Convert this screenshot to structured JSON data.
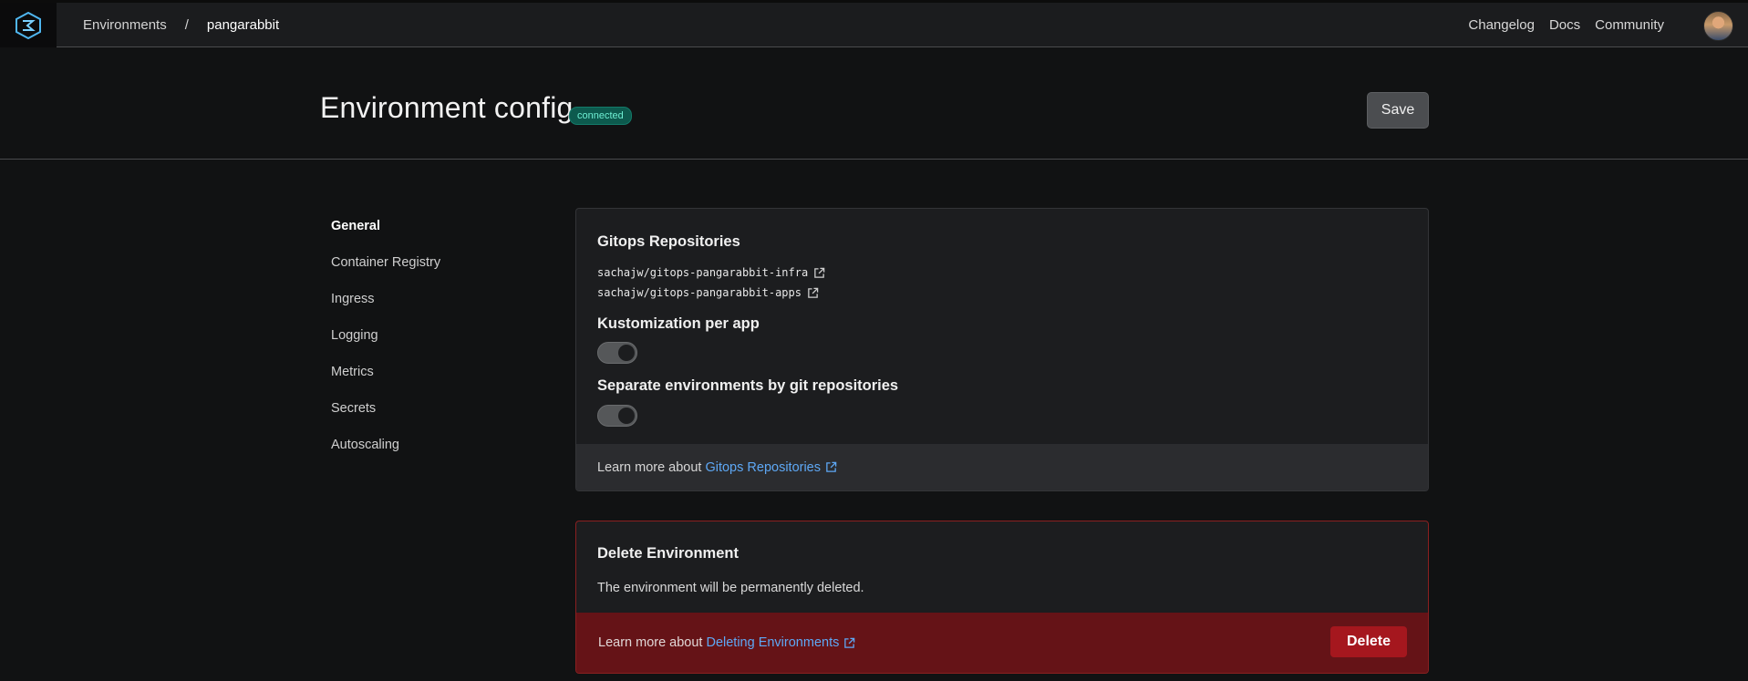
{
  "nav": {
    "breadcrumb": [
      "Environments",
      "pangarabbit"
    ],
    "separator": "/",
    "links": [
      "Changelog",
      "Docs",
      "Community"
    ]
  },
  "header": {
    "title": "Environment config",
    "status": "connected",
    "save_label": "Save"
  },
  "sidebar": {
    "items": [
      "General",
      "Container Registry",
      "Ingress",
      "Logging",
      "Metrics",
      "Secrets",
      "Autoscaling"
    ],
    "active": "General"
  },
  "gitops": {
    "title": "Gitops Repositories",
    "repos": [
      "sachajw/gitops-pangarabbit-infra",
      "sachajw/gitops-pangarabbit-apps"
    ],
    "kustomization_title": "Kustomization per app",
    "kustomization_enabled": true,
    "separate_title": "Separate environments by git repositories",
    "separate_enabled": true,
    "learn_prefix": "Learn more about",
    "learn_link": "Gitops Repositories"
  },
  "delete": {
    "title": "Delete Environment",
    "description": "The environment will be permanently deleted.",
    "learn_prefix": "Learn more about",
    "learn_link": "Deleting Environments",
    "button_label": "Delete"
  },
  "colors": {
    "accent_link": "#5ea8f5",
    "badge_bg": "#0d5a4e",
    "danger": "#a5171e"
  }
}
